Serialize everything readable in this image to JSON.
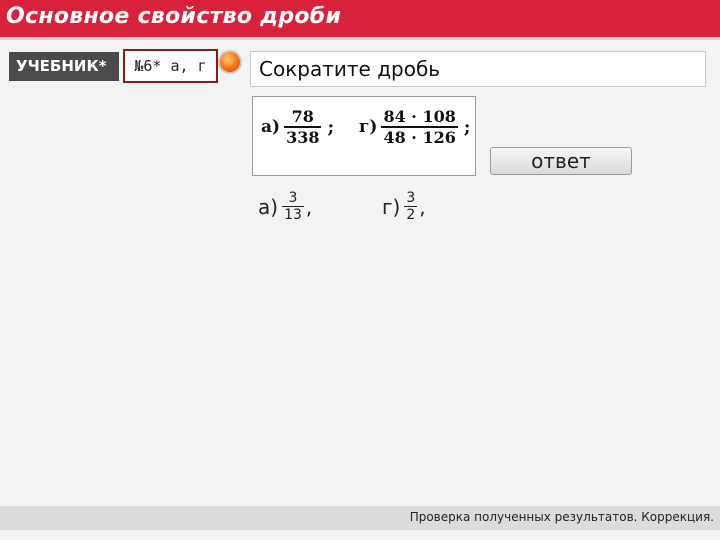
{
  "header": {
    "title": "Основное свойство дроби"
  },
  "toolbar": {
    "textbook_label": "УЧЕБНИК*",
    "number_label": "№6* а, г",
    "task_text": "Сократите дробь",
    "answer_label": "ответ"
  },
  "problem": {
    "a": {
      "label": "а)",
      "num": "78",
      "den": "338",
      "sep": ";"
    },
    "g": {
      "label": "г)",
      "num": "84 · 108",
      "den": "48 · 126",
      "sep": ";"
    }
  },
  "answers": {
    "a": {
      "label": "а)",
      "num": "3",
      "den": "13",
      "sep": ","
    },
    "g": {
      "label": "г)",
      "num": "3",
      "den": "2",
      "sep": ","
    }
  },
  "footer": {
    "text": "Проверка полученных результатов. Коррекция."
  },
  "colors": {
    "header_bg": "#d8213a",
    "textbook_bg": "#4a4a4a",
    "number_border": "#8b1a1a"
  }
}
